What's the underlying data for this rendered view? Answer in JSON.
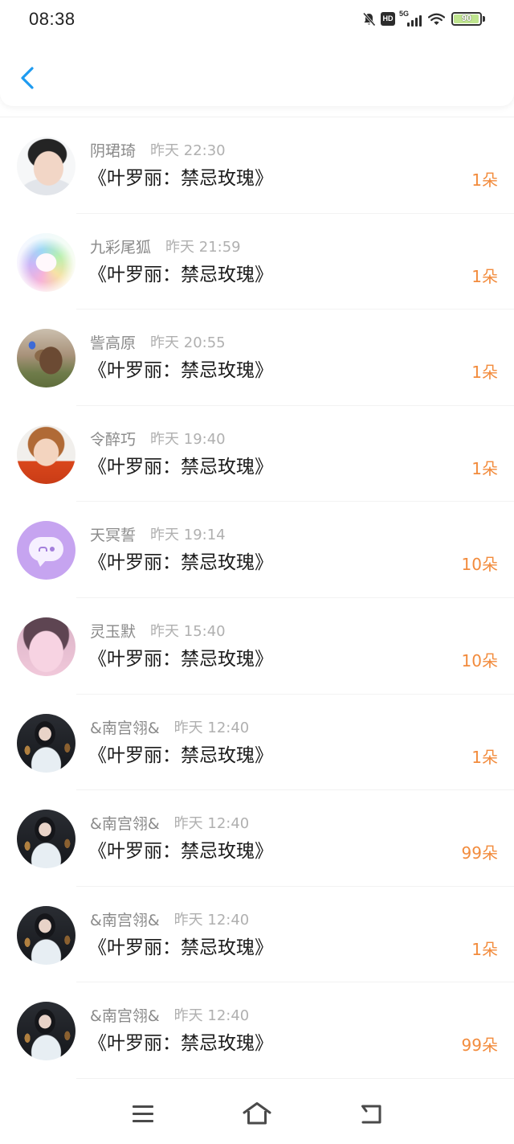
{
  "status_bar": {
    "time": "08:38",
    "hd_label": "HD",
    "network_label": "5G",
    "battery_level": "90",
    "icons": [
      "bell-off-icon",
      "hd-icon",
      "signal-5g-icon",
      "wifi-icon",
      "battery-icon"
    ]
  },
  "header": {
    "back_icon": "chevron-left-icon"
  },
  "colors": {
    "accent": "#1e9bf0",
    "count": "#f28b3c",
    "title": "#1c1c1c",
    "name": "#8a8a8a",
    "time": "#b0b0b0"
  },
  "list": {
    "items": [
      {
        "name": "阴珺琦",
        "time": "昨天 22:30",
        "title": "《叶罗丽：禁忌玫瑰》",
        "count": "1朵"
      },
      {
        "name": "九彩尾狐",
        "time": "昨天 21:59",
        "title": "《叶罗丽：禁忌玫瑰》",
        "count": "1朵"
      },
      {
        "name": "訾高原",
        "time": "昨天 20:55",
        "title": "《叶罗丽：禁忌玫瑰》",
        "count": "1朵"
      },
      {
        "name": "令醉巧",
        "time": "昨天 19:40",
        "title": "《叶罗丽：禁忌玫瑰》",
        "count": "1朵"
      },
      {
        "name": "天冥誓",
        "time": "昨天 19:14",
        "title": "《叶罗丽：禁忌玫瑰》",
        "count": "10朵"
      },
      {
        "name": "灵玉默",
        "time": "昨天 15:40",
        "title": "《叶罗丽：禁忌玫瑰》",
        "count": "10朵"
      },
      {
        "name": "&南宫翎&",
        "time": "昨天 12:40",
        "title": "《叶罗丽：禁忌玫瑰》",
        "count": "1朵"
      },
      {
        "name": "&南宫翎&",
        "time": "昨天 12:40",
        "title": "《叶罗丽：禁忌玫瑰》",
        "count": "99朵"
      },
      {
        "name": "&南宫翎&",
        "time": "昨天 12:40",
        "title": "《叶罗丽：禁忌玫瑰》",
        "count": "1朵"
      },
      {
        "name": "&南宫翎&",
        "time": "昨天 12:40",
        "title": "《叶罗丽：禁忌玫瑰》",
        "count": "99朵"
      }
    ]
  },
  "nav_bar": {
    "icons": [
      "menu-icon",
      "home-icon",
      "back-icon"
    ]
  }
}
